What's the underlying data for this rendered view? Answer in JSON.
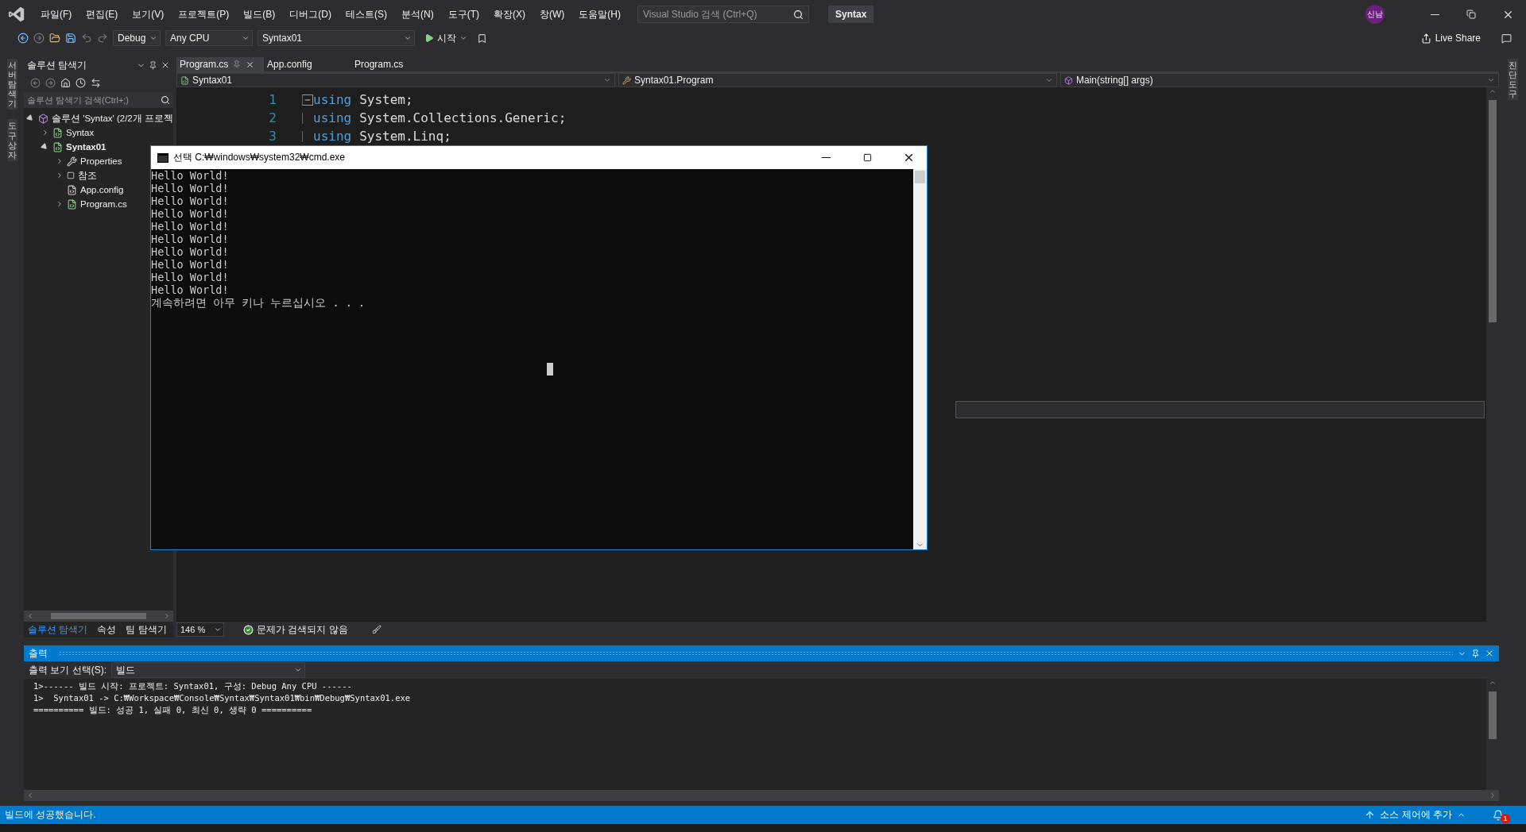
{
  "menu": [
    "파일(F)",
    "편집(E)",
    "보기(V)",
    "프로젝트(P)",
    "빌드(B)",
    "디버그(D)",
    "테스트(S)",
    "분석(N)",
    "도구(T)",
    "확장(X)",
    "창(W)",
    "도움말(H)"
  ],
  "search": {
    "placeholder": "Visual Studio 검색 (Ctrl+Q)"
  },
  "solution_title": "Syntax",
  "avatar": "신남",
  "toolbar": {
    "configuration": "Debug",
    "platform": "Any CPU",
    "startup_project": "Syntax01",
    "start": "시작",
    "live_share": "Live Share"
  },
  "left_strip": [
    "서버 탐색기",
    "도구 상자"
  ],
  "right_strip": [
    "진단 도구"
  ],
  "solution_explorer": {
    "title": "솔루션 탐색기",
    "search_placeholder": "솔루션 탐색기 검색(Ctrl+;)",
    "tree": [
      {
        "label": "솔루션 'Syntax' (2/2개 프로젝",
        "kind": "solution",
        "expanded": true,
        "children": [
          {
            "label": "Syntax",
            "kind": "project",
            "expanded": false,
            "bold": false
          },
          {
            "label": "Syntax01",
            "kind": "project",
            "expanded": true,
            "bold": true,
            "children": [
              {
                "label": "Properties",
                "kind": "properties",
                "expanded": false
              },
              {
                "label": "참조",
                "kind": "references",
                "expanded": false
              },
              {
                "label": "App.config",
                "kind": "config"
              },
              {
                "label": "Program.cs",
                "kind": "csfile",
                "expanded": false
              }
            ]
          }
        ]
      }
    ],
    "tabs": [
      {
        "label": "솔루션 탐색기",
        "selected": true
      },
      {
        "label": "속성",
        "selected": false
      },
      {
        "label": "팀 탐색기",
        "selected": false
      }
    ]
  },
  "editor": {
    "tabs": [
      {
        "label": "Program.cs",
        "selected": true
      },
      {
        "label": "App.config",
        "selected": false
      },
      {
        "label": "Program.cs",
        "selected": false
      }
    ],
    "nav": [
      "Syntax01",
      "Syntax01.Program",
      "Main(string[] args)"
    ],
    "lines": [
      {
        "number": "1",
        "keyword": "using",
        "text": "System;",
        "fold": true
      },
      {
        "number": "2",
        "keyword": "using",
        "text": "System.Collections.Generic;",
        "fold": false
      },
      {
        "number": "3",
        "keyword": "using",
        "text": "System.Linq;",
        "fold": false
      }
    ],
    "zoom": "146 %",
    "issues": "문제가 검색되지 않음"
  },
  "console": {
    "title": "선택 C:₩windows₩system32₩cmd.exe",
    "lines": [
      "Hello World!",
      "Hello World!",
      "Hello World!",
      "Hello World!",
      "Hello World!",
      "Hello World!",
      "Hello World!",
      "Hello World!",
      "Hello World!",
      "Hello World!",
      "계속하려면 아무 키나 누르십시오 . . ."
    ]
  },
  "output": {
    "title": "출력",
    "source_label": "출력 보기 선택(S):",
    "source": "빌드",
    "lines": [
      "1>------ 빌드 시작: 프로젝트: Syntax01, 구성: Debug Any CPU ------",
      "1>  Syntax01 -> C:₩Workspace₩Console₩Syntax₩Syntax01₩bin₩Debug₩Syntax01.exe",
      "========== 빌드: 성공 1, 실패 0, 최신 0, 생략 0 =========="
    ]
  },
  "status_bar": {
    "message": "빌드에 성공했습니다.",
    "source_control": "소스 제어에 추가",
    "notifications": "1"
  }
}
